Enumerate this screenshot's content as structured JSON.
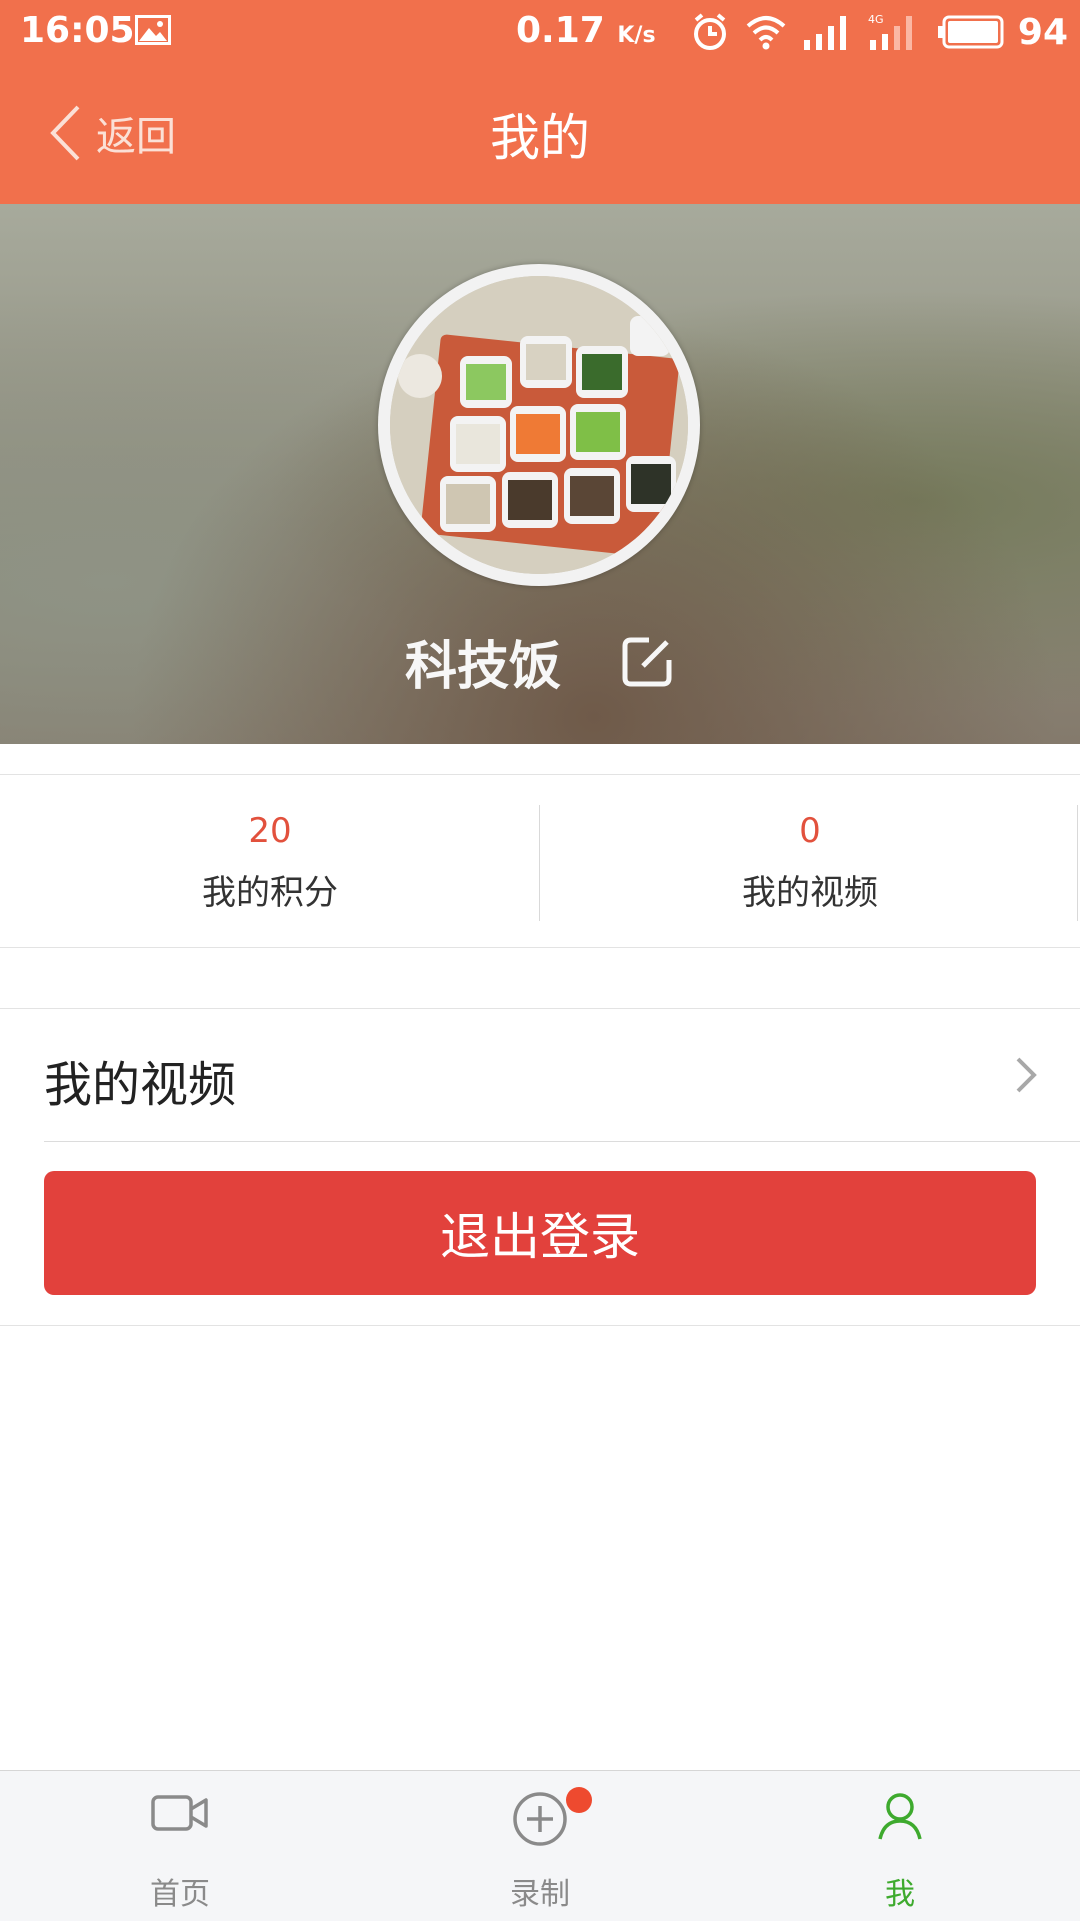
{
  "status_bar": {
    "time": "16:05",
    "net_speed": "0.17",
    "net_unit": "K/s",
    "battery": "94",
    "icons": [
      "gallery-icon",
      "alarm-icon",
      "wifi-icon",
      "signal-icon",
      "signal-4g-icon",
      "battery-icon"
    ]
  },
  "header": {
    "back_label": "返回",
    "title": "我的"
  },
  "profile": {
    "username": "科技饭"
  },
  "stats": [
    {
      "value": "20",
      "label": "我的积分"
    },
    {
      "value": "0",
      "label": "我的视频"
    }
  ],
  "menu": {
    "items": [
      {
        "label": "我的视频"
      }
    ],
    "logout_label": "退出登录"
  },
  "tabbar": {
    "tabs": [
      {
        "label": "首页",
        "icon": "video-camera-icon"
      },
      {
        "label": "录制",
        "icon": "plus-circle-icon"
      },
      {
        "label": "我",
        "icon": "person-icon"
      }
    ],
    "active_index": 2
  },
  "colors": {
    "header_bg": "#f1704c",
    "accent_red": "#e2413c",
    "stat_number": "#e2513d",
    "tab_active": "#3eaa2e",
    "badge": "#ee4a2f"
  }
}
